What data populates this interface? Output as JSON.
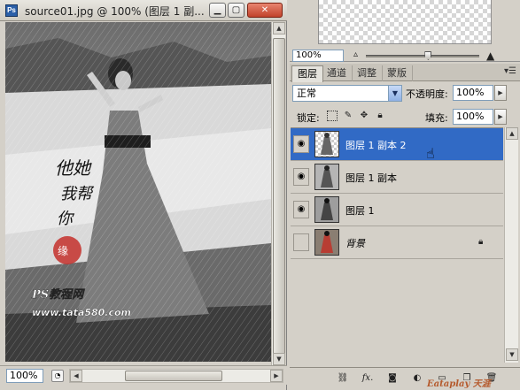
{
  "document": {
    "title": "source01.jpg @ 100% (图层 1 副...",
    "app_icon": "Ps",
    "zoom": "100%",
    "canvas_text": {
      "calligraphy_lines": [
        "他她",
        "我帮",
        "你"
      ],
      "brand": "PS教程网",
      "url": "www.tata580.com"
    }
  },
  "navigator": {
    "zoom": "100%",
    "slider_level_percent": 0.55
  },
  "layers_panel": {
    "tabs": [
      {
        "label": "图层",
        "active": true
      },
      {
        "label": "通道",
        "active": false
      },
      {
        "label": "调整",
        "active": false
      },
      {
        "label": "蒙版",
        "active": false
      }
    ],
    "menu_icon": "panel-menu-icon",
    "blend_mode": "正常",
    "opacity_label": "不透明度:",
    "opacity": "100%",
    "lock_label": "锁定:",
    "fill_label": "填充:",
    "fill": "100%",
    "layers": [
      {
        "name": "图层 1 副本 2",
        "visible": true,
        "selected": true,
        "italic": false,
        "locked": false
      },
      {
        "name": "图层 1 副本",
        "visible": true,
        "selected": false,
        "italic": false,
        "locked": false
      },
      {
        "name": "图层 1",
        "visible": true,
        "selected": false,
        "italic": false,
        "locked": false
      },
      {
        "name": "背景",
        "visible": false,
        "selected": false,
        "italic": true,
        "locked": true
      }
    ],
    "footer_icons": [
      "link-icon",
      "fx-icon",
      "mask-icon",
      "adjustment-icon",
      "group-icon",
      "new-layer-icon",
      "trash-icon"
    ]
  },
  "watermark": "Eataplay 天涯",
  "colors": {
    "selection": "#316ac5",
    "panel_bg": "#d4d0c8"
  }
}
